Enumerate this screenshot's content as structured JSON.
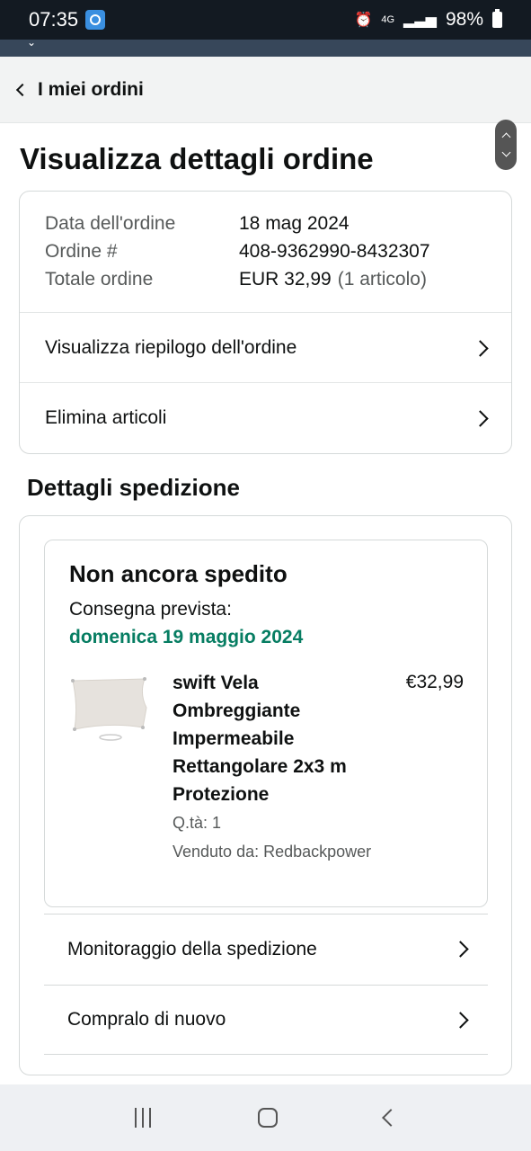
{
  "status_bar": {
    "time": "07:35",
    "network": "4G",
    "battery": "98%",
    "icons": [
      "alarm-icon",
      "network-4g-icon",
      "signal-icon",
      "battery-icon"
    ]
  },
  "header": {
    "back_label": "I miei ordini"
  },
  "page_title": "Visualizza dettagli ordine",
  "order_summary": {
    "rows": [
      {
        "label": "Data dell'ordine",
        "value": "18 mag 2024"
      },
      {
        "label": "Ordine #",
        "value": "408-9362990-8432307"
      },
      {
        "label": "Totale ordine",
        "value": "EUR 32,99",
        "extra": "(1 articolo)"
      }
    ],
    "links": [
      {
        "label": "Visualizza riepilogo dell'ordine"
      },
      {
        "label": "Elimina articoli"
      }
    ]
  },
  "shipment": {
    "section_title": "Dettagli spedizione",
    "status": "Non ancora spedito",
    "delivery_label": "Consegna prevista:",
    "delivery_date": "domenica 19 maggio 2024",
    "product": {
      "name": "swift Vela Ombreggiante Impermeabile Rettangolare 2x3 m Protezione",
      "price": "€32,99",
      "quantity": "Q.tà: 1",
      "seller": "Venduto da: Redbackpower"
    },
    "links": [
      {
        "label": "Monitoraggio della spedizione"
      },
      {
        "label": "Compralo di nuovo"
      }
    ]
  },
  "colors": {
    "status_bar_bg": "#131a22",
    "delivery_green": "#067d62",
    "header_bg": "#f2f3f3"
  }
}
